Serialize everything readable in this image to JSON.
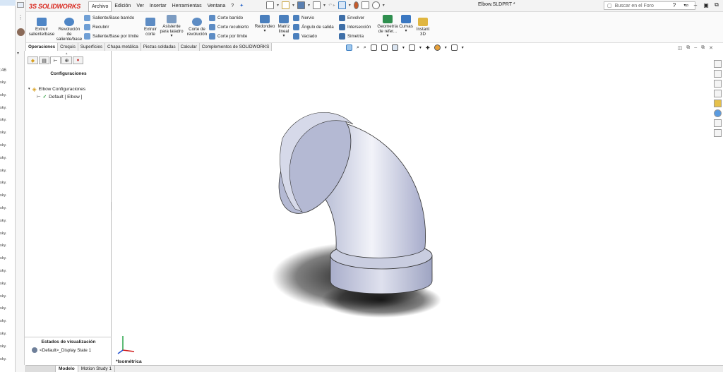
{
  "app": {
    "brand": "SOLIDWORKS",
    "document_title": "Elbow.SLDPRT *"
  },
  "menu": [
    "Archivo",
    "Edición",
    "Ver",
    "Insertar",
    "Herramientas",
    "Ventana",
    "?"
  ],
  "search": {
    "placeholder": "Buscar en el Foro"
  },
  "ribbon": {
    "extrude": "Extruir saliente/base",
    "revolve": "Revolución de saliente/base",
    "sweep": "Saliente/Base barrido",
    "loft": "Recubrir",
    "boundary": "Saliente/Base por límite",
    "cut_extrude": "Extruir corte",
    "hole_wizard": "Asistente para taladro",
    "cut_revolve": "Corte de revolución",
    "cut_sweep": "Corte barrido",
    "cut_loft": "Corte recubierto",
    "cut_boundary": "Corte por límite",
    "fillet": "Redondeo",
    "pattern": "Matriz lineal",
    "rib": "Nervio",
    "draft": "Ángulo de salida",
    "shell": "Vaciado",
    "wrap": "Envolver",
    "intersect": "Intersección",
    "mirror": "Simetría",
    "ref_geometry": "Geometría de refer...",
    "curves": "Curvas",
    "instant3d": "Instant 3D"
  },
  "command_tabs": [
    "Operaciones",
    "Croquis",
    "Superficies",
    "Chapa metálica",
    "Piezas soldadas",
    "Calcular",
    "Complementos de SOLIDWORKS"
  ],
  "panel": {
    "heading": "Configuraciones",
    "tree_root": "Elbow Configuraciones",
    "tree_child": "Default [ Elbow ]",
    "display_heading": "Estados de visualización",
    "display_state": "<Default>_Display State 1"
  },
  "bottom_tabs": [
    "Modelo",
    "Motion Study 1"
  ],
  "view_label": "*Isométrica",
  "left_strip": {
    "time": ":46",
    "labels": [
      "sky.",
      "sky.",
      "sky.",
      "sky.",
      "sky.",
      "sky.",
      "sky.",
      "sky.",
      "sky.",
      "sky.",
      "sky.",
      "sky.",
      "sky.",
      "sky.",
      "sky.",
      "sky.",
      "sky.",
      "sky.",
      "sky.",
      "sky.",
      "sky.",
      "sky.",
      "sky."
    ]
  },
  "colors": {
    "accent_red": "#d9261c",
    "selected_blue": "#9fc7ec",
    "part_shade": "#b9bfd6"
  }
}
